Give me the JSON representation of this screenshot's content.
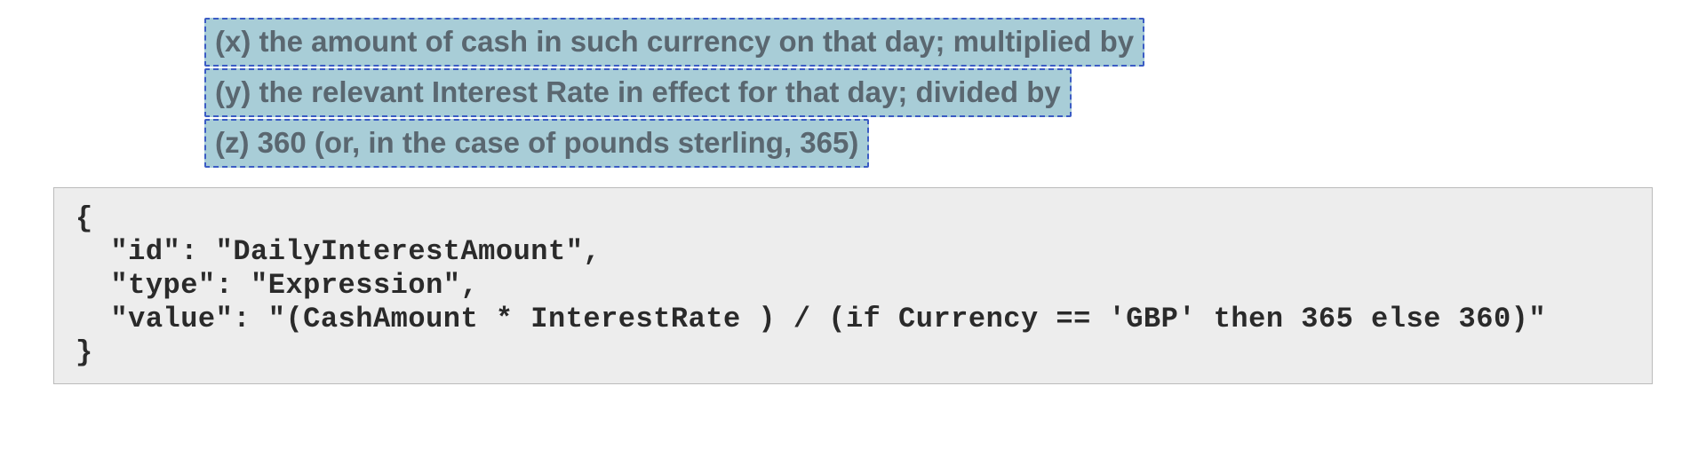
{
  "definitions": {
    "x": "(x) the amount of cash in such currency on that day; multiplied by",
    "y": "(y) the relevant Interest Rate in effect for that day; divided by",
    "z": "(z) 360 (or, in the case of pounds sterling, 365)"
  },
  "code": {
    "line1": "{",
    "line2": "  \"id\": \"DailyInterestAmount\",",
    "line3": "  \"type\": \"Expression\",",
    "line4": "  \"value\": \"(CashAmount * InterestRate ) / (if Currency == 'GBP' then 365 else 360)\"",
    "line5": "}"
  }
}
